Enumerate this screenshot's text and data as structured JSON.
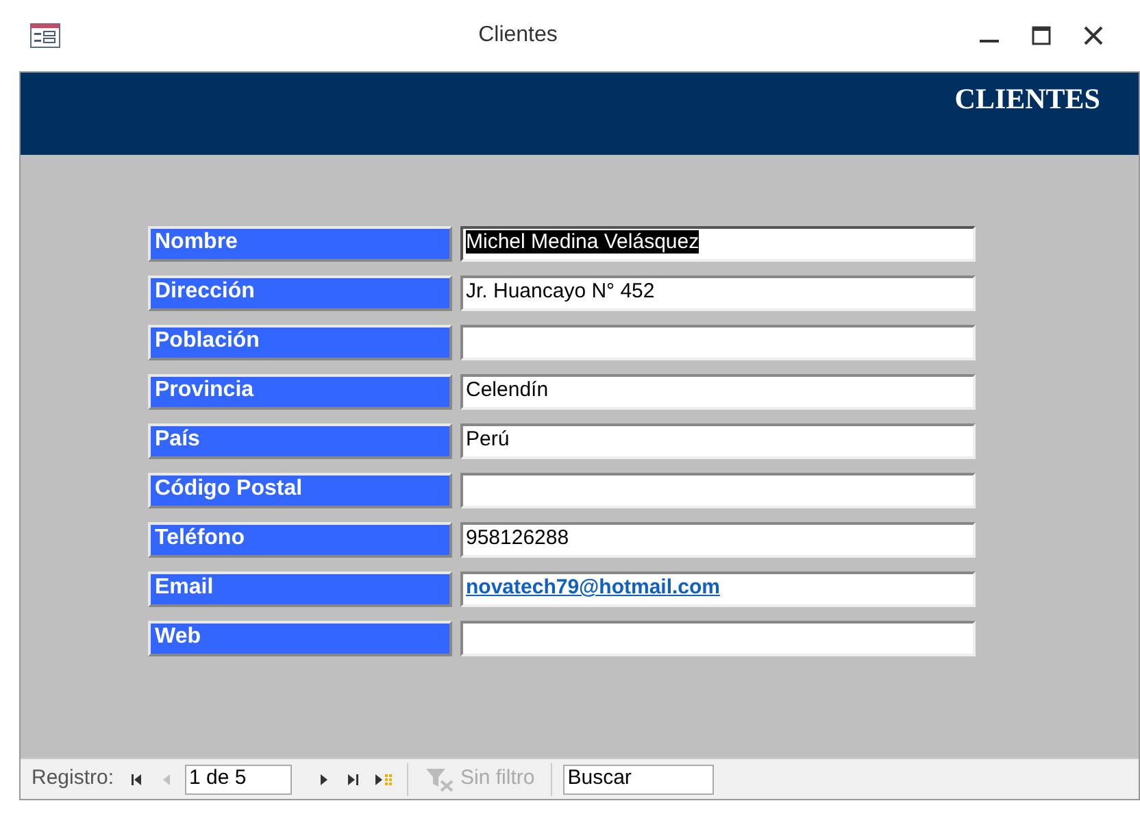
{
  "window": {
    "title": "Clientes"
  },
  "header": {
    "title": "CLIENTES"
  },
  "fields": [
    {
      "label": "Nombre",
      "value": "Michel Medina Velásquez",
      "kind": "text",
      "selected": true
    },
    {
      "label": "Dirección",
      "value": "Jr. Huancayo N° 452",
      "kind": "text",
      "selected": false
    },
    {
      "label": "Población",
      "kind": "text",
      "selected": false
    },
    {
      "label": "Provincia",
      "value": "Celendín",
      "kind": "text",
      "selected": false
    },
    {
      "label": "País",
      "value": "Perú",
      "kind": "text",
      "selected": false
    },
    {
      "label": "Código Postal",
      "kind": "text",
      "selected": false
    },
    {
      "label": "Teléfono",
      "value": "958126288",
      "kind": "text",
      "selected": false
    },
    {
      "label": "Email",
      "value": "novatech79@hotmail.com",
      "kind": "link",
      "selected": false
    },
    {
      "label": "Web",
      "kind": "text",
      "selected": false
    }
  ],
  "navigation": {
    "label": "Registro:",
    "record": "1 de 5",
    "buttons_before": [
      {
        "kind": "first",
        "disabled": false
      },
      {
        "kind": "prev",
        "disabled": true
      }
    ],
    "buttons_after": [
      {
        "kind": "next",
        "disabled": false
      },
      {
        "kind": "last",
        "disabled": false
      },
      {
        "kind": "new",
        "disabled": false
      }
    ],
    "filter": {
      "label": "Sin filtro",
      "disabled": true
    },
    "search": {
      "placeholder": "Buscar"
    }
  }
}
